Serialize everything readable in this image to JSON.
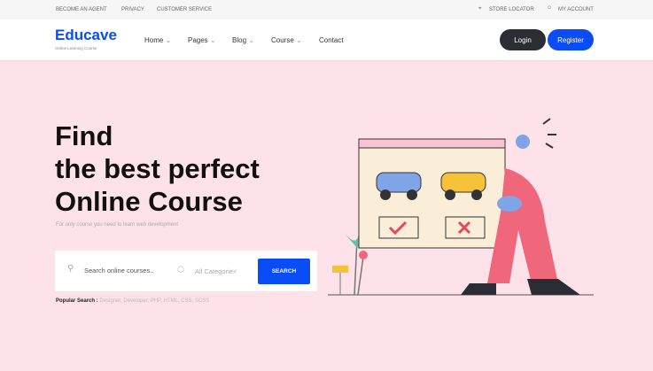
{
  "topbar": {
    "links": [
      "BECOME AN AGENT",
      "PRIVACY",
      "CUSTOMER SERVICE"
    ],
    "store_locator": "STORE LOCATOR",
    "my_account": "MY ACCOUNT"
  },
  "nav": {
    "logo": "Educave",
    "logo_sub": "Online Learning Course",
    "items": [
      "Home",
      "Pages",
      "Blog",
      "Course",
      "Contact"
    ],
    "login": "Login",
    "register": "Register"
  },
  "hero": {
    "line1": "Find",
    "line2": "the best perfect",
    "line3": "Online Course",
    "subtitle": "For only course you need to learn web development"
  },
  "search": {
    "placeholder": "Search online courses..",
    "category": "All Categorie",
    "button": "SEARCH"
  },
  "popular": {
    "label": "Popular Search :",
    "items": "Designer, Developer, PHP, HTML, CSS, SCSS"
  },
  "colors": {
    "accent": "#0a4cf5",
    "background": "#fde2ea",
    "dark": "#2a2d33"
  }
}
